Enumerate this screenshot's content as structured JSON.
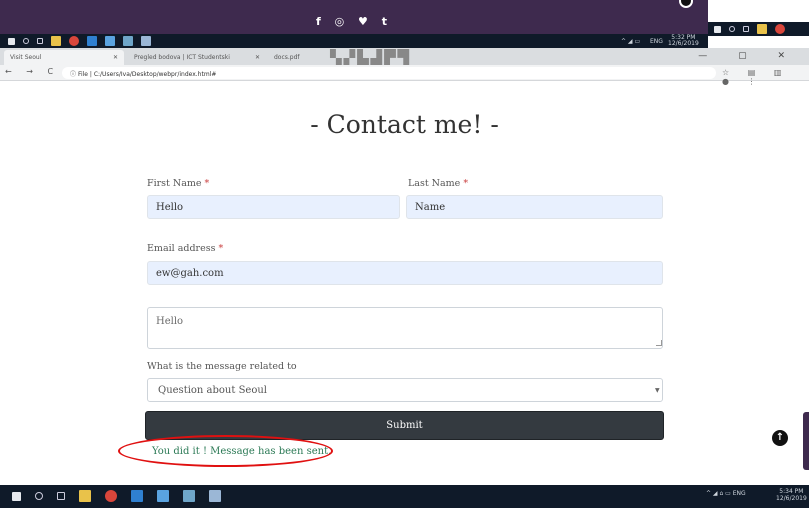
{
  "footer": {
    "social_icons": "f ◎ ♥ t"
  },
  "browser": {
    "tabs": [
      {
        "label": "Visit Seoul"
      },
      {
        "label": "Pregled bodova | ICT Studentski"
      },
      {
        "label": "docs.pdf"
      }
    ],
    "url": "File | C:/Users/Iva/Desktop/webpr/index.html#"
  },
  "taskbar_top": {
    "lang": "ENG",
    "time": "5:32 PM",
    "date": "12/6/2019"
  },
  "taskbar_bottom": {
    "lang": "ENG",
    "time": "5:34 PM",
    "date": "12/6/2019"
  },
  "form": {
    "title": "- Contact me! -",
    "first_name_label": "First Name",
    "first_name_value": "Hello",
    "last_name_label": "Last Name",
    "last_name_value": "Name",
    "email_label": "Email address",
    "email_value": "ew@gah.com",
    "message_value": "Hello",
    "select_label": "What is the message related to",
    "select_value": "Question about Seoul",
    "submit_label": "Submit",
    "required_marker": "*",
    "success_message": "You did it ! Message has been sent."
  },
  "colors": {
    "footer_purple": "#3e2a4e",
    "submit_bg": "#343a40",
    "success_green": "#2c7a56",
    "annotation_red": "#e01010",
    "autofill_blue": "#e8f0fe"
  }
}
